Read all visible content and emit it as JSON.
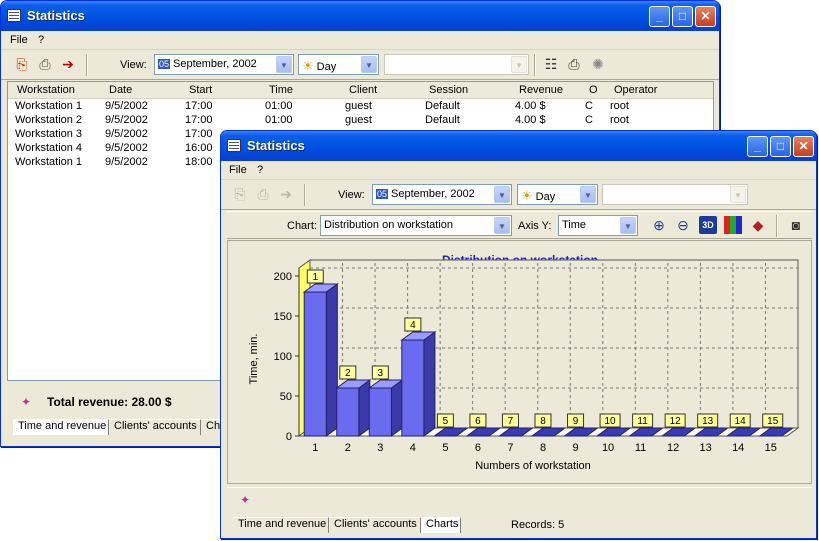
{
  "back_window": {
    "title": "Statistics",
    "menu": [
      "File",
      "?"
    ],
    "view_label": "View:",
    "view_value": "September, 2002",
    "cal_badge": "05",
    "period_value": "Day",
    "columns": [
      "Workstation",
      "Date",
      "Start",
      "Time",
      "Client",
      "Session",
      "Revenue",
      "O",
      "Operator"
    ],
    "rows": [
      [
        "Workstation 1",
        "9/5/2002",
        "17:00",
        "01:00",
        "guest",
        "Default",
        "4.00 $",
        "C",
        "root"
      ],
      [
        "Workstation 2",
        "9/5/2002",
        "17:00",
        "01:00",
        "guest",
        "Default",
        "4.00 $",
        "C",
        "root"
      ],
      [
        "Workstation 3",
        "9/5/2002",
        "17:00",
        "",
        "",
        "",
        "",
        "",
        ""
      ],
      [
        "Workstation 4",
        "9/5/2002",
        "16:00",
        "",
        "",
        "",
        "",
        "",
        ""
      ],
      [
        "Workstation 1",
        "9/5/2002",
        "18:00",
        "",
        "",
        "",
        "",
        "",
        ""
      ]
    ],
    "total_revenue": "Total revenue: 28.00 $",
    "tabs": [
      "Time and revenue",
      "Clients' accounts",
      "Cha"
    ]
  },
  "front_window": {
    "title": "Statistics",
    "menu": [
      "File",
      "?"
    ],
    "view_label": "View:",
    "view_value": "September, 2002",
    "cal_badge": "05",
    "period_value": "Day",
    "chart_label": "Chart:",
    "chart_value": "Distribution on workstation",
    "axis_y_label": "Axis Y:",
    "axis_y_value": "Time",
    "tabs": [
      "Time and revenue",
      "Clients' accounts",
      "Charts"
    ],
    "records": "Records: 5"
  },
  "colors": {
    "title_blue": "#0055e5",
    "chart_title": "#1f1fc0",
    "bar": "#6b6bf0",
    "chart_bg": "#ece9d8",
    "label_box": "#ffff99"
  },
  "chart_data": {
    "type": "bar",
    "title": "Distribution on workstation",
    "xlabel": "Numbers of workstation",
    "ylabel": "Time, min.",
    "categories": [
      "1",
      "2",
      "3",
      "4",
      "5",
      "6",
      "7",
      "8",
      "9",
      "10",
      "11",
      "12",
      "13",
      "14",
      "15"
    ],
    "values": [
      180,
      60,
      60,
      120,
      0,
      0,
      0,
      0,
      0,
      0,
      0,
      0,
      0,
      0,
      0
    ],
    "bar_labels": [
      "1",
      "2",
      "3",
      "4",
      "5",
      "6",
      "7",
      "8",
      "9",
      "10",
      "11",
      "12",
      "13",
      "14",
      "15"
    ],
    "yticks": [
      "0",
      "50",
      "100",
      "150",
      "200"
    ],
    "ylim": [
      0,
      210
    ],
    "grid": true,
    "style": "3d"
  }
}
